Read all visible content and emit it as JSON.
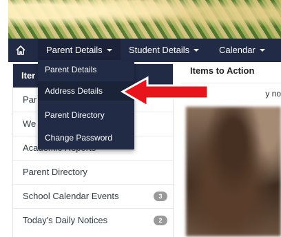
{
  "navbar": {
    "home_icon": "home-icon",
    "items": [
      {
        "label": "Parent Details"
      },
      {
        "label": "Student Details"
      },
      {
        "label": "Calendar"
      }
    ]
  },
  "dropdown": {
    "items": [
      {
        "label": "Parent Details"
      },
      {
        "label": "Address Details"
      },
      {
        "label": "Parent Directory"
      },
      {
        "label": "Change Password"
      }
    ]
  },
  "sidebar": {
    "header": "Iter",
    "items": [
      {
        "label": "Par"
      },
      {
        "label": "We"
      },
      {
        "label": "Academic Reports"
      },
      {
        "label": "Parent Directory"
      },
      {
        "label": "School Calendar Events",
        "badge": "3"
      },
      {
        "label": "Today's Daily Notices",
        "badge": "2"
      }
    ]
  },
  "main": {
    "title": "Items to Action",
    "notice_fragment": "y no"
  },
  "annotation": {
    "arrow_color": "#e8141c",
    "arrow_outline": "#ffffff"
  }
}
